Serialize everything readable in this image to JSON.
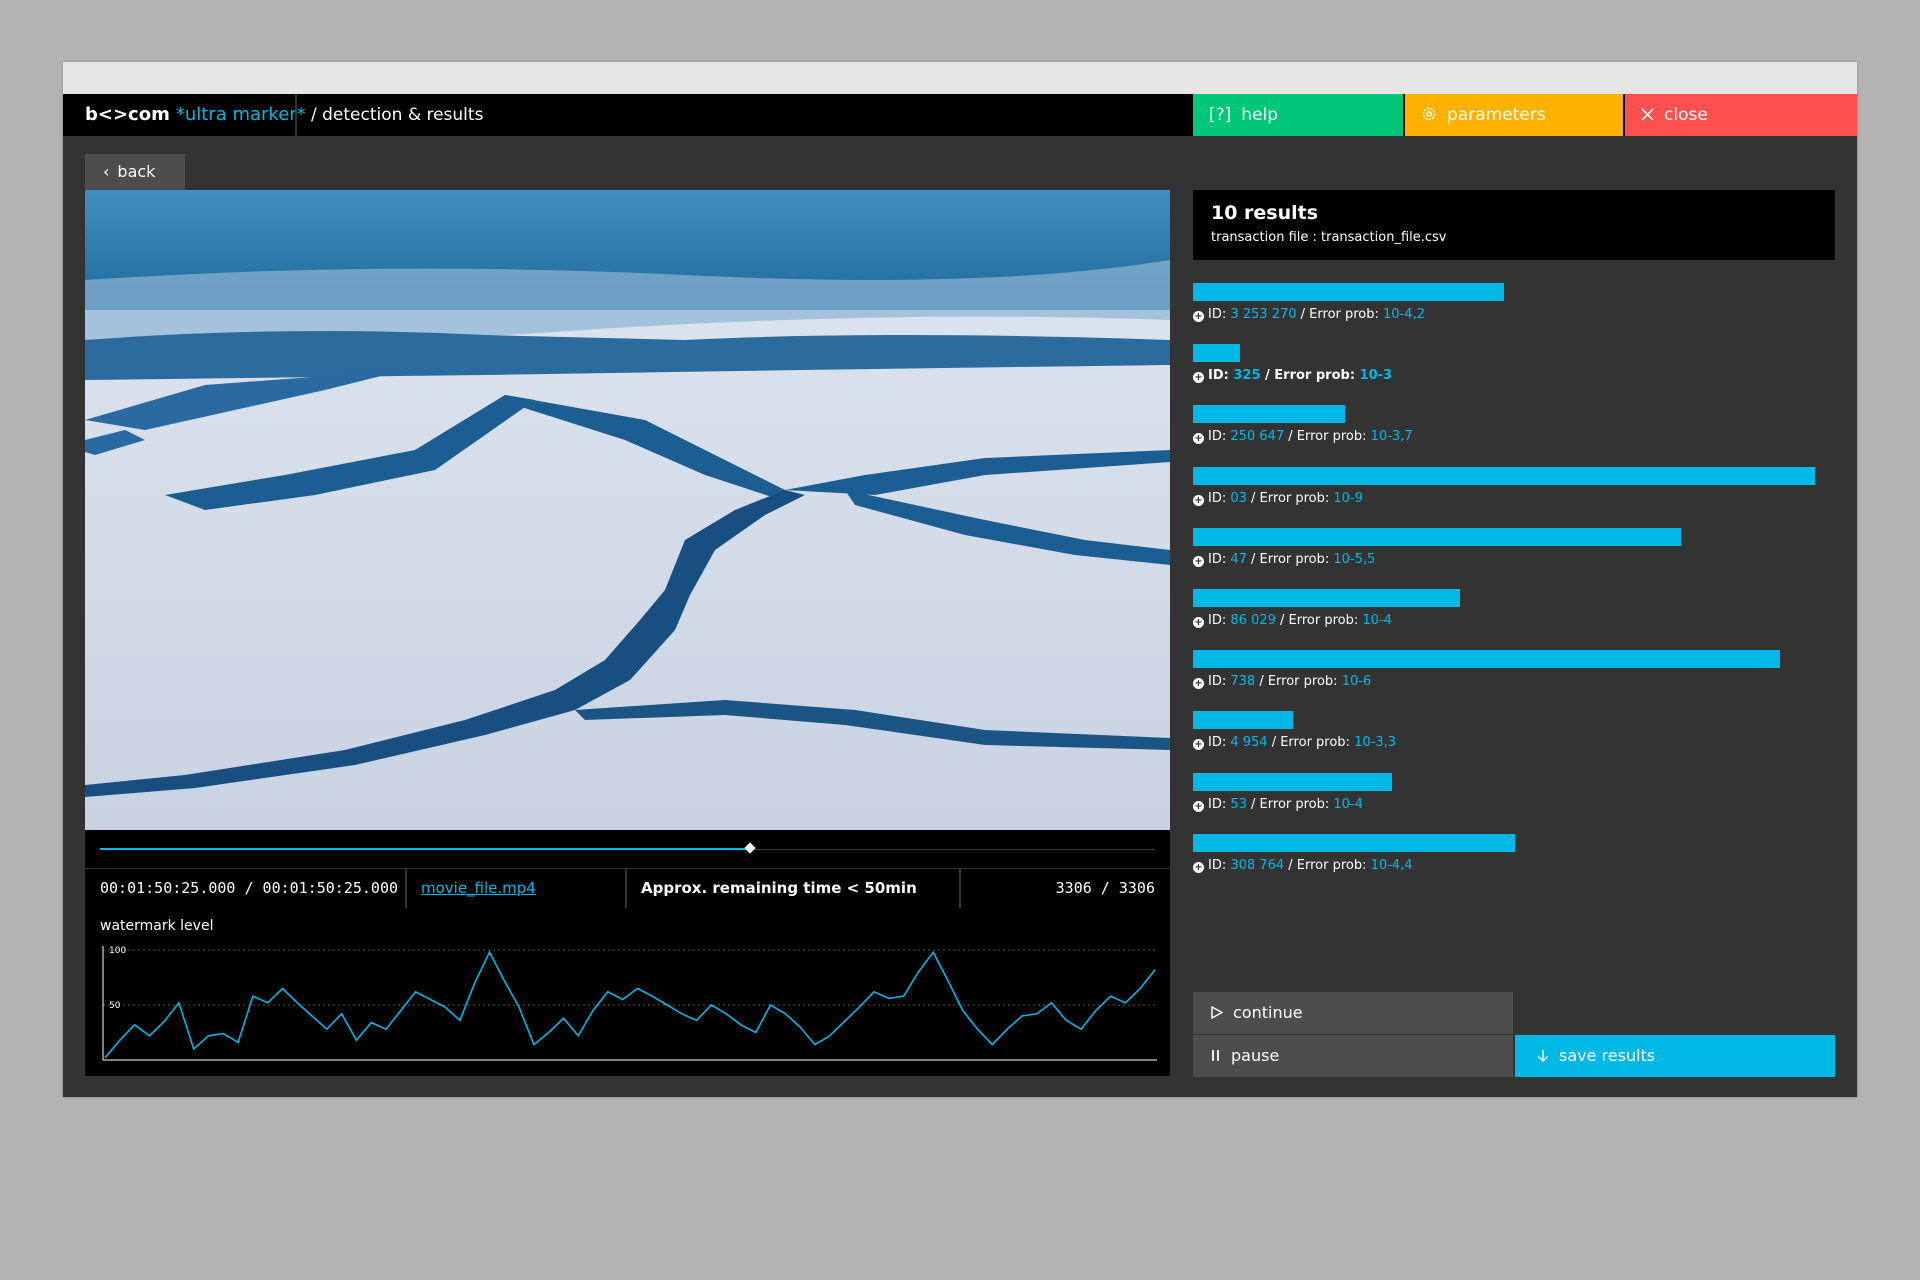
{
  "header": {
    "logo": "b<>com",
    "app_name": "*ultra marker*",
    "breadcrumb": "/  detection & results",
    "help_label": "help",
    "help_icon": "[?]",
    "params_label": "parameters",
    "close_label": "close"
  },
  "back_label": "back",
  "player": {
    "progress": 0.616,
    "timecode": "00:01:50:25.000 / 00:01:50:25.000",
    "file_name": "movie_file.mp4",
    "remaining": "Approx. remaining time < 50min",
    "frames": "3306 / 3306"
  },
  "chart_data": {
    "type": "line",
    "title": "watermark level",
    "ylim": [
      0,
      100
    ],
    "yticks": [
      "100",
      "50"
    ],
    "grid": true,
    "series": [
      {
        "color": "#00b8e6",
        "values": [
          2,
          18,
          32,
          22,
          35,
          52,
          10,
          22,
          24,
          16,
          58,
          52,
          65,
          52,
          40,
          28,
          42,
          18,
          34,
          28,
          45,
          62,
          55,
          48,
          36,
          70,
          98,
          72,
          48,
          14,
          25,
          38,
          22,
          45,
          62,
          55,
          65,
          58,
          50,
          42,
          36,
          50,
          42,
          32,
          25,
          50,
          42,
          30,
          14,
          22,
          35,
          48,
          62,
          56,
          58,
          80,
          98,
          72,
          45,
          28,
          14,
          28,
          40,
          42,
          52,
          36,
          28,
          45,
          58,
          52,
          65,
          82
        ]
      }
    ],
    "colors": {
      "line": "#00b8e6",
      "grid": "#555555",
      "axis": "#ffffff"
    }
  },
  "results": {
    "count": "10 results",
    "file": "transaction file : transaction_file.csv",
    "id_prefix": "ID: ",
    "err_prefix": " / Error prob: ",
    "items": [
      {
        "id": "3 253 270",
        "err": "10-4,2",
        "score": 0.5,
        "bold": false
      },
      {
        "id": "325",
        "err": "10-3",
        "score": 0.075,
        "bold": true
      },
      {
        "id": "250 647",
        "err": "10-3,7",
        "score": 0.245,
        "bold": false
      },
      {
        "id": "03",
        "err": "10-9",
        "score": 1.0,
        "bold": false
      },
      {
        "id": "47",
        "err": "10-5,5",
        "score": 0.785,
        "bold": false
      },
      {
        "id": "86 029",
        "err": "10-4",
        "score": 0.43,
        "bold": false
      },
      {
        "id": "738",
        "err": "10-6",
        "score": 0.943,
        "bold": false
      },
      {
        "id": "4 954",
        "err": "10-3,3",
        "score": 0.16,
        "bold": false
      },
      {
        "id": "53",
        "err": "10-4",
        "score": 0.32,
        "bold": false
      },
      {
        "id": "308 764",
        "err": "10-4,4",
        "score": 0.517,
        "bold": false
      }
    ]
  },
  "controls": {
    "continue_label": "continue",
    "pause_label": "pause",
    "save_label": "save results"
  },
  "colors": {
    "accent": "#00b8e6",
    "help": "#00c878",
    "params": "#ffb300",
    "close": "#ff5050",
    "panel": "#333333"
  }
}
